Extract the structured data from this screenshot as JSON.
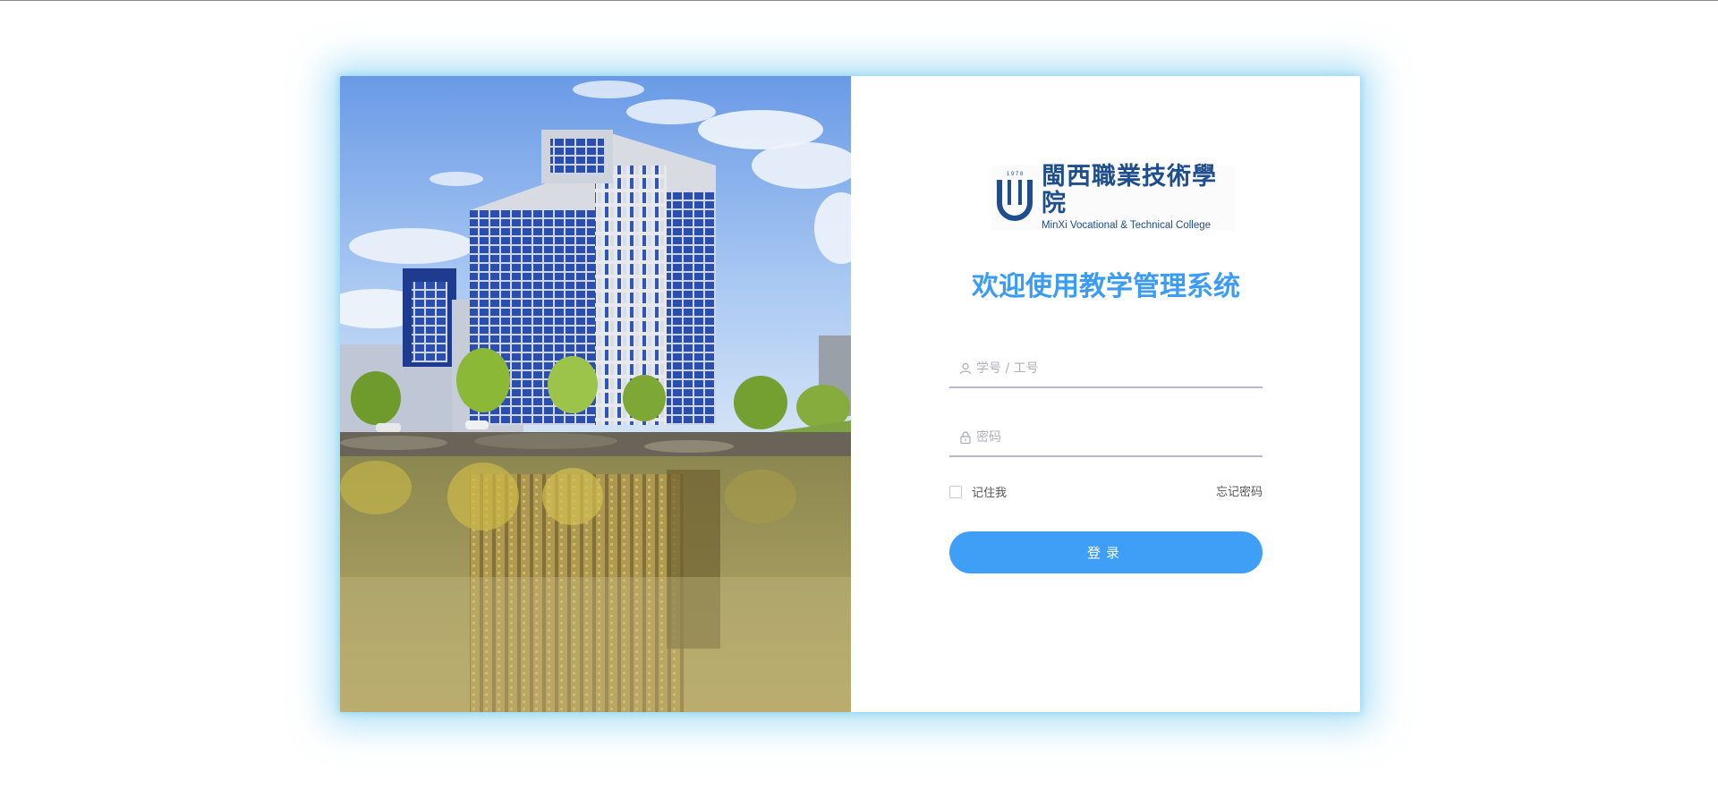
{
  "logo": {
    "name_cn": "閩西職業技術學院",
    "name_en": "MinXi Vocational & Technical College",
    "year": "1 9 7 8"
  },
  "welcome_title": "欢迎使用教学管理系统",
  "form": {
    "username_placeholder": "学号 / 工号",
    "password_placeholder": "密码",
    "remember_label": "记住我",
    "forgot_label": "忘记密码",
    "login_label": "登录"
  },
  "colors": {
    "accent": "#3f9ff6",
    "title": "#3c9cf5",
    "logo": "#1f4e8c",
    "glow": "#6ec8f0"
  },
  "icons": {
    "username": "user-icon",
    "password": "lock-icon"
  }
}
